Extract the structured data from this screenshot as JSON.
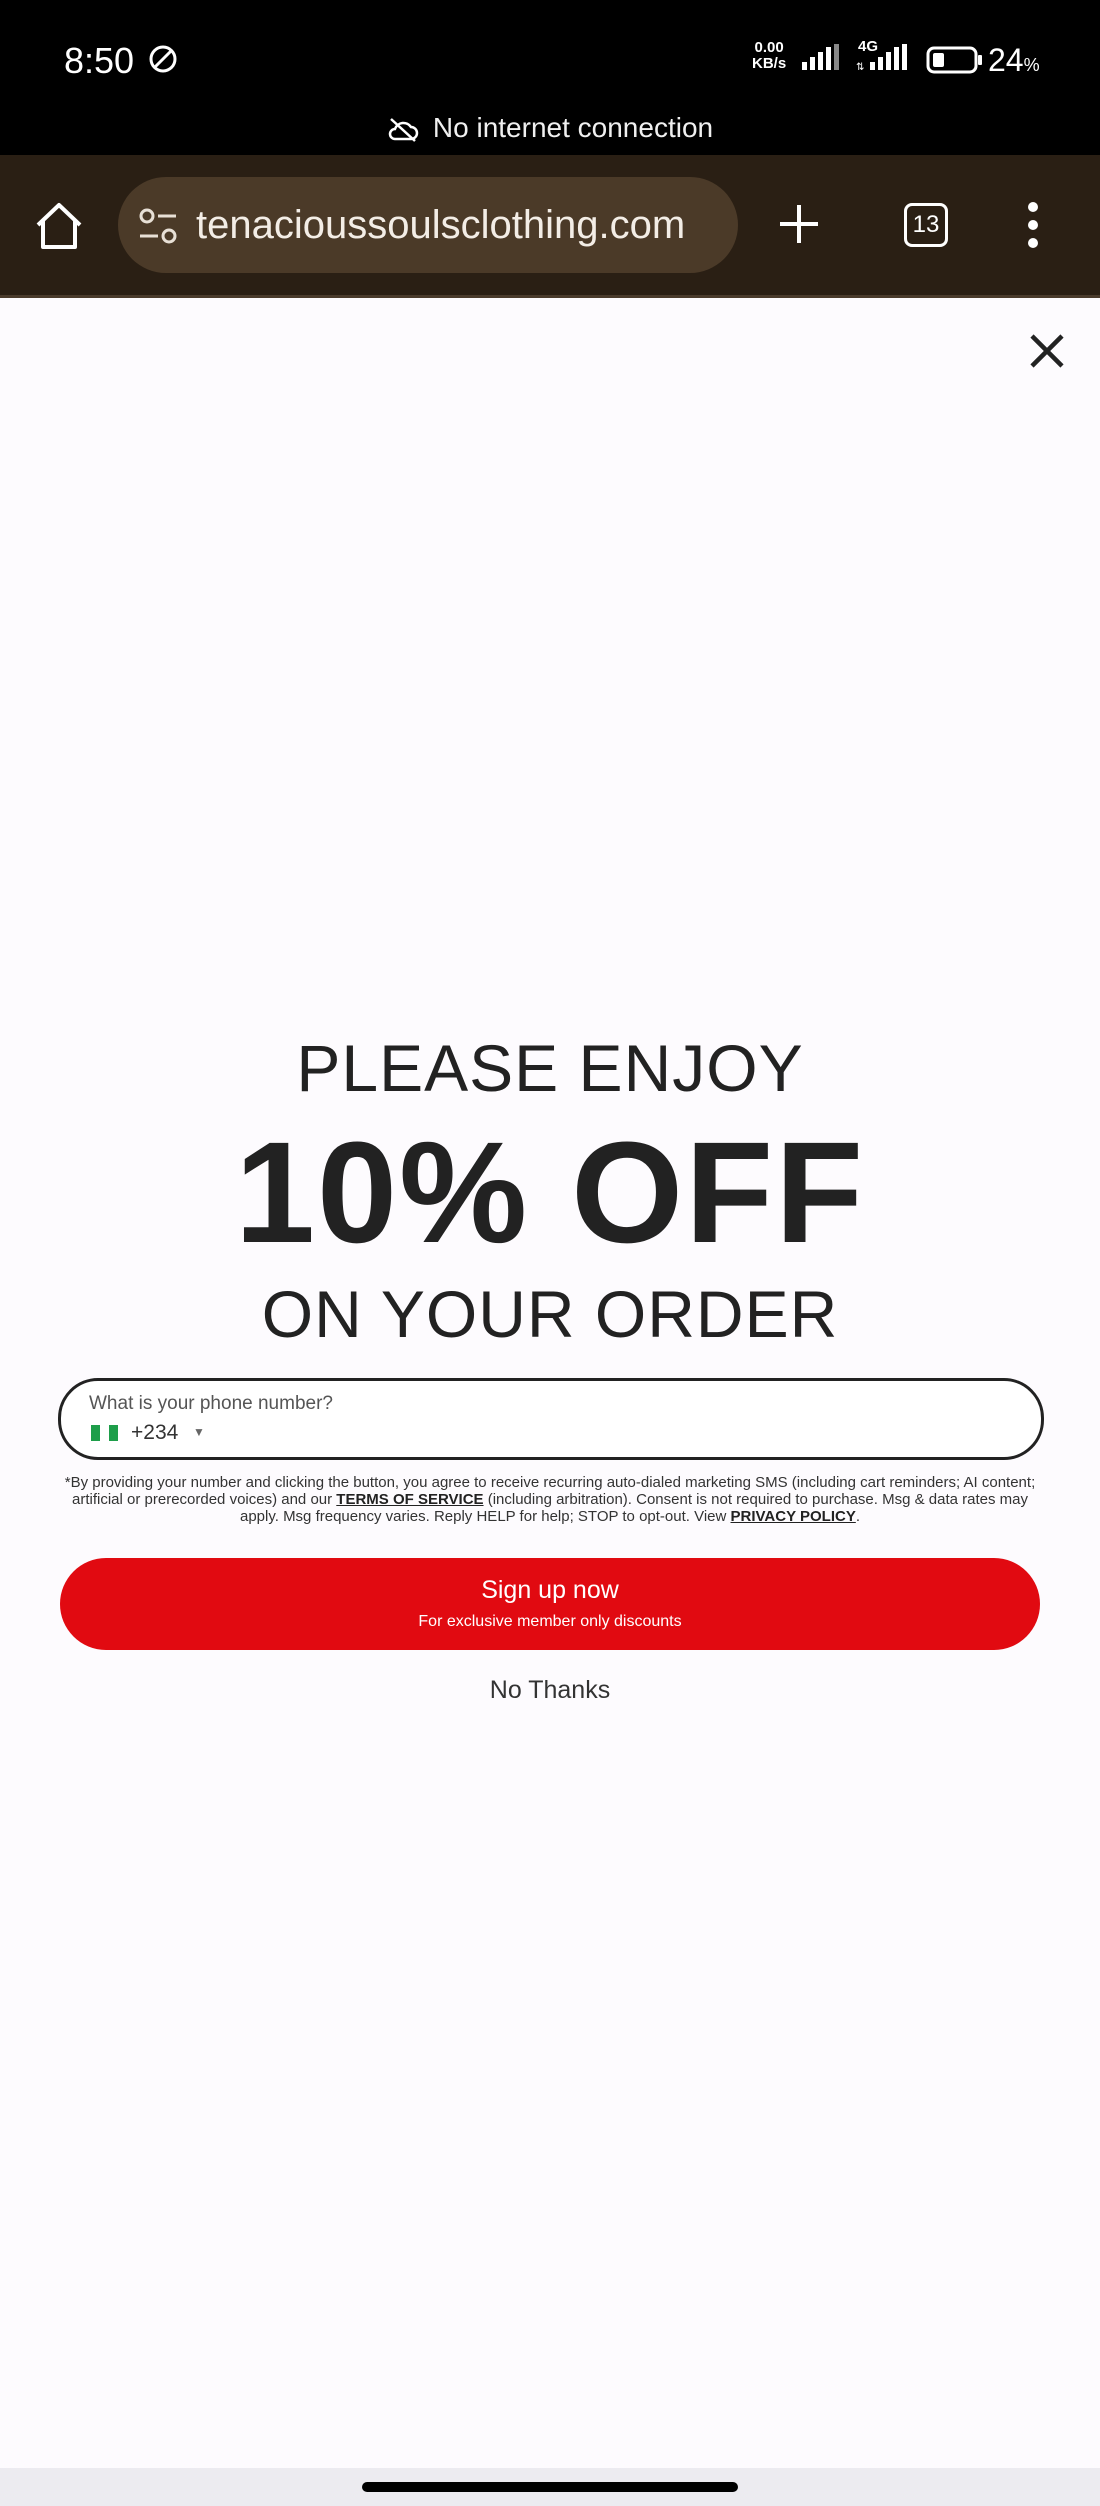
{
  "status_bar": {
    "time": "8:50",
    "net_speed_value": "0.00",
    "net_speed_unit": "KB/s",
    "network_type": "4G",
    "battery_percent": "24",
    "battery_unit": "%",
    "offline_message": "No internet connection"
  },
  "browser": {
    "url": "tenacioussoulsclothing.com",
    "tab_count": "13"
  },
  "popup": {
    "headline_top": "PLEASE ENJOY",
    "headline_main": "10% OFF",
    "headline_bottom": "ON YOUR ORDER",
    "phone_label": "What is your phone number?",
    "dial_code": "+234",
    "disclaimer_part1": "*By providing your number and clicking the button, you agree to receive recurring auto-dialed marketing SMS (including cart reminders; AI content; artificial or prerecorded voices) and our ",
    "terms_link": "TERMS OF SERVICE",
    "disclaimer_part2": " (including arbitration). Consent is not required to purchase. Msg & data rates may apply. Msg frequency varies. Reply HELP for help; STOP to opt-out. View ",
    "privacy_link": "PRIVACY POLICY",
    "disclaimer_end": ".",
    "signup_label": "Sign up now",
    "signup_sublabel": "For exclusive member only discounts",
    "decline_label": "No Thanks"
  },
  "colors": {
    "accent_red": "#e10a11",
    "toolbar_brown": "#2a1f14",
    "urlbar_brown": "#4b3a28",
    "flag_green": "#1e9e4a"
  }
}
